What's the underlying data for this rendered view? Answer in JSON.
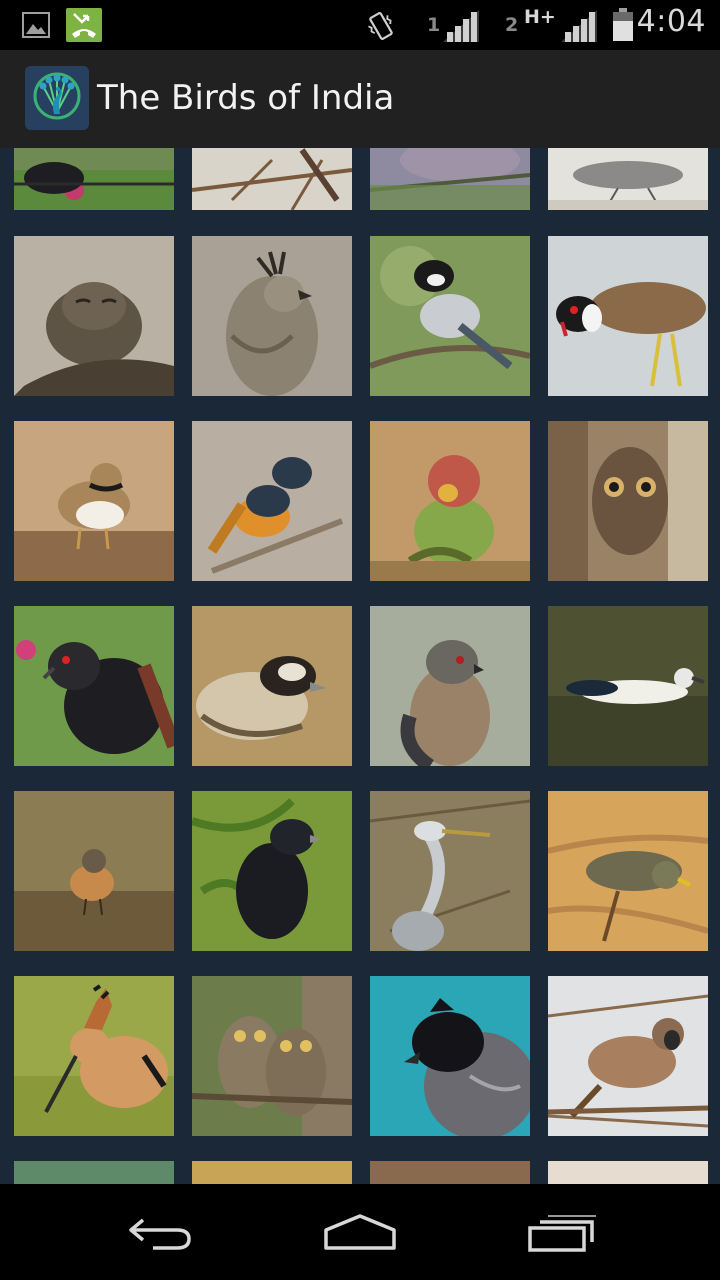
{
  "status_bar": {
    "left_icons": [
      "picture-icon",
      "missed-call-icon"
    ],
    "sim1_label": "1",
    "sim2_label": "2",
    "network_type": "H+",
    "time": "4:04",
    "colors": {
      "missed_call": "#7cb342"
    }
  },
  "action_bar": {
    "title": "The Birds of India",
    "icon": "peacock-logo-icon"
  },
  "grid": {
    "columns": 4,
    "colors": {
      "background": "#1b2838"
    },
    "tiles": [
      {
        "bird": "bird-on-wire-photo",
        "partial": "top"
      },
      {
        "bird": "bird-on-branch-photo",
        "partial": "top"
      },
      {
        "bird": "dove-photo",
        "partial": "top"
      },
      {
        "bird": "grey-bird-photo",
        "partial": "top"
      },
      {
        "bird": "nightjar-photo"
      },
      {
        "bird": "crested-hawk-eagle-photo"
      },
      {
        "bird": "great-tit-photo"
      },
      {
        "bird": "red-wattled-lapwing-photo"
      },
      {
        "bird": "little-ringed-plover-photo"
      },
      {
        "bird": "redstart-photo"
      },
      {
        "bird": "plum-headed-parakeet-photo"
      },
      {
        "bird": "owlet-photo"
      },
      {
        "bird": "coucal-photo"
      },
      {
        "bird": "sparrow-lark-photo"
      },
      {
        "bird": "shikra-photo"
      },
      {
        "bird": "comb-duck-photo"
      },
      {
        "bird": "wheatear-photo"
      },
      {
        "bird": "drongo-photo"
      },
      {
        "bird": "grey-heron-photo"
      },
      {
        "bird": "warbler-photo"
      },
      {
        "bird": "hoopoe-photo"
      },
      {
        "bird": "spotted-owlets-photo"
      },
      {
        "bird": "red-vented-bulbul-photo"
      },
      {
        "bird": "house-sparrow-photo"
      },
      {
        "bird": "partial-photo-1",
        "partial": "bottom"
      },
      {
        "bird": "partial-photo-2",
        "partial": "bottom"
      },
      {
        "bird": "partial-photo-3",
        "partial": "bottom"
      },
      {
        "bird": "partial-photo-4",
        "partial": "bottom"
      }
    ]
  },
  "nav_bar": {
    "buttons": [
      "back-icon",
      "home-icon",
      "recent-apps-icon"
    ]
  }
}
